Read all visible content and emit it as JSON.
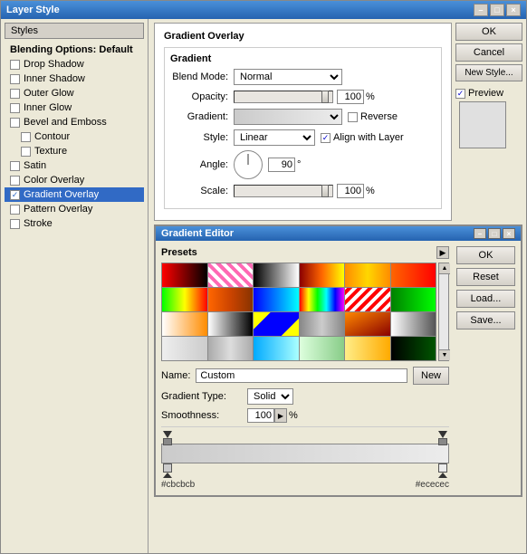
{
  "window": {
    "title": "Layer Style",
    "close_btn": "×",
    "min_btn": "–",
    "max_btn": "□"
  },
  "left_panel": {
    "styles_header": "Styles",
    "items": [
      {
        "label": "Blending Options: Default",
        "type": "header",
        "checked": false,
        "indent": 0
      },
      {
        "label": "Drop Shadow",
        "type": "item",
        "checked": false,
        "indent": 0
      },
      {
        "label": "Inner Shadow",
        "type": "item",
        "checked": false,
        "indent": 0
      },
      {
        "label": "Outer Glow",
        "type": "item",
        "checked": false,
        "indent": 0
      },
      {
        "label": "Inner Glow",
        "type": "item",
        "checked": false,
        "indent": 0
      },
      {
        "label": "Bevel and Emboss",
        "type": "item",
        "checked": false,
        "indent": 0
      },
      {
        "label": "Contour",
        "type": "item",
        "checked": false,
        "indent": 1
      },
      {
        "label": "Texture",
        "type": "item",
        "checked": false,
        "indent": 1
      },
      {
        "label": "Satin",
        "type": "item",
        "checked": false,
        "indent": 0
      },
      {
        "label": "Color Overlay",
        "type": "item",
        "checked": false,
        "indent": 0
      },
      {
        "label": "Gradient Overlay",
        "type": "item",
        "checked": true,
        "indent": 0,
        "active": true
      },
      {
        "label": "Pattern Overlay",
        "type": "item",
        "checked": false,
        "indent": 0
      },
      {
        "label": "Stroke",
        "type": "item",
        "checked": false,
        "indent": 0
      }
    ]
  },
  "right_panel": {
    "ok_btn": "OK",
    "cancel_btn": "Cancel",
    "new_style_btn": "New Style...",
    "preview_label": "Preview",
    "preview_checked": true
  },
  "gradient_overlay": {
    "title": "Gradient Overlay",
    "gradient_label": "Gradient",
    "blend_mode_label": "Blend Mode:",
    "blend_mode_value": "Normal",
    "opacity_label": "Opacity:",
    "opacity_value": "100",
    "opacity_unit": "%",
    "gradient_label2": "Gradient:",
    "reverse_label": "Reverse",
    "style_label": "Style:",
    "style_value": "Linear",
    "align_layer_label": "Align with Layer",
    "angle_label": "Angle:",
    "angle_value": "90",
    "angle_unit": "°",
    "scale_label": "Scale:",
    "scale_value": "100",
    "scale_unit": "%"
  },
  "gradient_editor": {
    "title": "Gradient Editor",
    "presets_label": "Presets",
    "ok_btn": "OK",
    "reset_btn": "Reset",
    "load_btn": "Load...",
    "save_btn": "Save...",
    "new_btn": "New",
    "name_label": "Name:",
    "name_value": "Custom",
    "gradient_type_label": "Gradient Type:",
    "gradient_type_value": "Solid",
    "smoothness_label": "Smoothness:",
    "smoothness_value": "100",
    "smoothness_unit": "%",
    "color_left": "#cbcbcb",
    "color_right": "#ececec",
    "swatches": [
      {
        "bg": "linear-gradient(to right, #ff0000, #000000)",
        "label": "s1"
      },
      {
        "bg": "repeating-linear-gradient(45deg, #ff69b4 0px, #ff69b4 4px, #ffffff 4px, #ffffff 8px)",
        "label": "s2"
      },
      {
        "bg": "linear-gradient(to right, #000000, #ffffff)",
        "label": "s3"
      },
      {
        "bg": "linear-gradient(to right, #8B0000, #ff6600, #ffff00)",
        "label": "s4"
      },
      {
        "bg": "linear-gradient(to right, #ff8c00, #ffd700, #ff8c00)",
        "label": "s5"
      },
      {
        "bg": "linear-gradient(to right, #ff6600, #ff0000)",
        "label": "s6"
      },
      {
        "bg": "linear-gradient(to right, #00ff00, #ffff00, #ff0000)",
        "label": "s7"
      },
      {
        "bg": "linear-gradient(to right, #ff6600, #cc4400, #883300)",
        "label": "s8"
      },
      {
        "bg": "linear-gradient(to right, #0000ff, #00ffff)",
        "label": "s9"
      },
      {
        "bg": "linear-gradient(to right, #ff0000, #ffff00, #00ff00, #00ffff, #0000ff, #ff00ff)",
        "label": "s10"
      },
      {
        "bg": "repeating-linear-gradient(-45deg, #ff0000 0px, #ff0000 4px, #ffffff 4px, #ffffff 8px)",
        "label": "s11"
      },
      {
        "bg": "linear-gradient(to right, #008000, #00ff00)",
        "label": "s12"
      },
      {
        "bg": "linear-gradient(to right, #ffffff, #ff8c00)",
        "label": "s13"
      },
      {
        "bg": "linear-gradient(to right, #ffffff, #000000)",
        "label": "s14"
      },
      {
        "bg": "linear-gradient(135deg, #ffff00 25%, transparent 25%, transparent 75%, #ffff00 75%), linear-gradient(135deg, #0000ff 25%, #0000ff 75%)",
        "label": "s15"
      },
      {
        "bg": "linear-gradient(to right, #888888, #cccccc, #888888)",
        "label": "s16"
      },
      {
        "bg": "linear-gradient(to bottom right, #ff8800, #880000)",
        "label": "s17"
      },
      {
        "bg": "linear-gradient(to right, #ffffff, #aaaaaa, #555555)",
        "label": "s18"
      },
      {
        "bg": "linear-gradient(to right, #eeeeee, #cccccc)",
        "label": "s19"
      },
      {
        "bg": "linear-gradient(to right, #aaaaaa, #dddddd, #aaaaaa)",
        "label": "s20"
      },
      {
        "bg": "linear-gradient(to right, #00aaff, #aaffff)",
        "label": "s21"
      },
      {
        "bg": "linear-gradient(to right, #ddffdd, #88cc88)",
        "label": "s22"
      },
      {
        "bg": "linear-gradient(to right, #ffee88, #ffaa00)",
        "label": "s23"
      },
      {
        "bg": "linear-gradient(to right, #000000, #005500)",
        "label": "s24"
      }
    ]
  }
}
